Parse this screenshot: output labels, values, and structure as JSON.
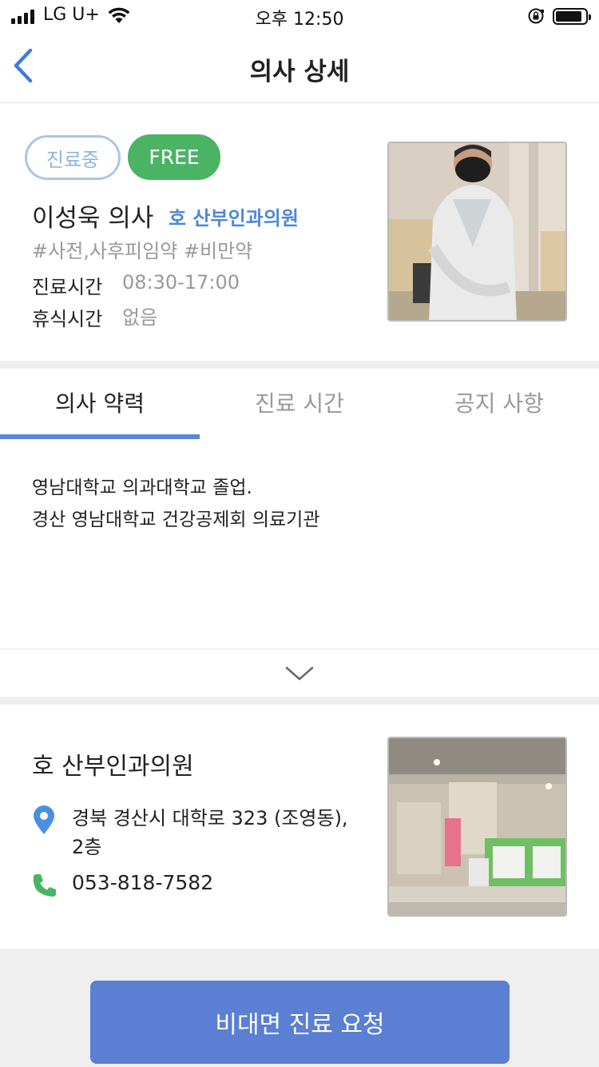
{
  "status_bar": {
    "carrier": "LG U+",
    "time": "오후 12:50"
  },
  "nav": {
    "title": "의사 상세",
    "back_icon": "chevron-left-icon"
  },
  "doctor": {
    "status_badge": "진료중",
    "free_badge": "FREE",
    "name": "이성욱 의사",
    "clinic": "호 산부인과의원",
    "tags": "#사전,사후피임약 #비만약",
    "hours_label": "진료시간",
    "hours_value": "08:30-17:00",
    "break_label": "휴식시간",
    "break_value": "없음"
  },
  "tabs": [
    {
      "label": "의사 약력",
      "active": true
    },
    {
      "label": "진료 시간",
      "active": false
    },
    {
      "label": "공지 사항",
      "active": false
    }
  ],
  "career": {
    "line1": "영남대학교 의과대학교 졸업.",
    "line2": "경산 영남대학교 건강공제회 의료기관"
  },
  "clinic": {
    "name": "호 산부인과의원",
    "address": "경북 경산시 대학로 323 (조영동), 2층",
    "phone": "053-818-7582"
  },
  "cta": {
    "label": "비대면 진료 요청"
  },
  "colors": {
    "accent": "#5b7fd2",
    "free_green": "#4bb464",
    "status_blue": "#8fb3e1",
    "clinic_link": "#4f86d8"
  }
}
